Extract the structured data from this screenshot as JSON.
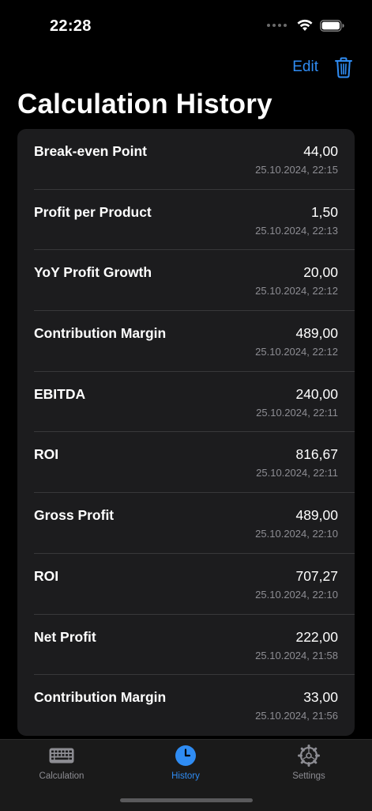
{
  "status_bar": {
    "time": "22:28",
    "icons": [
      "cellular-dots-icon",
      "wifi-icon",
      "battery-icon"
    ]
  },
  "nav": {
    "edit_label": "Edit",
    "trash_icon": "trash-icon",
    "accent_color": "#2f8cf3"
  },
  "page": {
    "title": "Calculation History"
  },
  "history": [
    {
      "name": "Break-even Point",
      "value": "44,00",
      "timestamp": "25.10.2024, 22:15"
    },
    {
      "name": "Profit per Product",
      "value": "1,50",
      "timestamp": "25.10.2024, 22:13"
    },
    {
      "name": "YoY Profit Growth",
      "value": "20,00",
      "timestamp": "25.10.2024, 22:12"
    },
    {
      "name": "Contribution Margin",
      "value": "489,00",
      "timestamp": "25.10.2024, 22:12"
    },
    {
      "name": "EBITDA",
      "value": "240,00",
      "timestamp": "25.10.2024, 22:11"
    },
    {
      "name": "ROI",
      "value": "816,67",
      "timestamp": "25.10.2024, 22:11"
    },
    {
      "name": "Gross Profit",
      "value": "489,00",
      "timestamp": "25.10.2024, 22:10"
    },
    {
      "name": "ROI",
      "value": "707,27",
      "timestamp": "25.10.2024, 22:10"
    },
    {
      "name": "Net Profit",
      "value": "222,00",
      "timestamp": "25.10.2024, 21:58"
    },
    {
      "name": "Contribution Margin",
      "value": "33,00",
      "timestamp": "25.10.2024, 21:56"
    }
  ],
  "tab_bar": {
    "items": [
      {
        "label": "Calculation",
        "icon": "keyboard-icon",
        "active": false
      },
      {
        "label": "History",
        "icon": "clock-icon",
        "active": true
      },
      {
        "label": "Settings",
        "icon": "gear-icon",
        "active": false
      }
    ]
  }
}
